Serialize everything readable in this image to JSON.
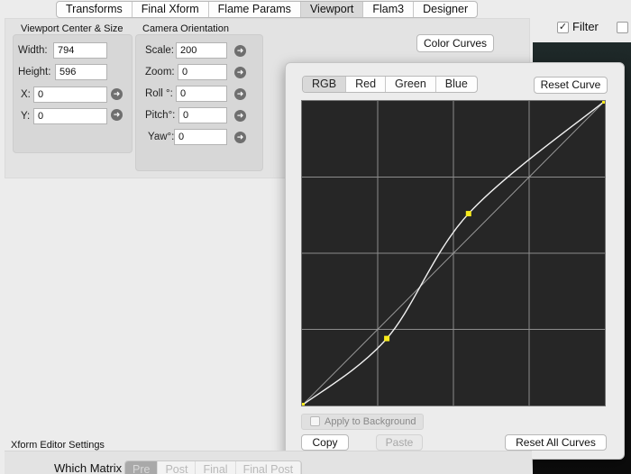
{
  "tabs": [
    "Transforms",
    "Final Xform",
    "Flame Params",
    "Viewport",
    "Flam3",
    "Designer"
  ],
  "active_tab": 3,
  "viewport_group": {
    "title": "Viewport Center & Size",
    "width_label": "Width:",
    "width_value": "794",
    "height_label": "Height:",
    "height_value": "596",
    "x_label": "X:",
    "x_value": "0",
    "y_label": "Y:",
    "y_value": "0"
  },
  "camera_group": {
    "title": "Camera Orientation",
    "scale_label": "Scale:",
    "scale_value": "200",
    "zoom_label": "Zoom:",
    "zoom_value": "0",
    "roll_label": "Roll °:",
    "roll_value": "0",
    "pitch_label": "Pitch°:",
    "pitch_value": "0",
    "yaw_label": "Yaw°:",
    "yaw_value": "0"
  },
  "color_curves_button": "Color Curves",
  "filter_label": "Filter",
  "popover": {
    "channels": [
      "RGB",
      "Red",
      "Green",
      "Blue"
    ],
    "active_channel": 0,
    "reset_curve": "Reset Curve",
    "apply_to_background": "Apply to Background",
    "copy": "Copy",
    "paste": "Paste",
    "reset_all": "Reset All Curves"
  },
  "curve": {
    "grid_divisions": 4,
    "control_points": [
      [
        0,
        0
      ],
      [
        0.28,
        0.22
      ],
      [
        0.55,
        0.63
      ],
      [
        1,
        1
      ]
    ]
  },
  "bottom": {
    "section_title": "Xform Editor Settings",
    "which_matrix_label": "Which Matrix",
    "matrix_options": [
      "Pre",
      "Post",
      "Final",
      "Final Post"
    ],
    "active_matrix": 0
  }
}
